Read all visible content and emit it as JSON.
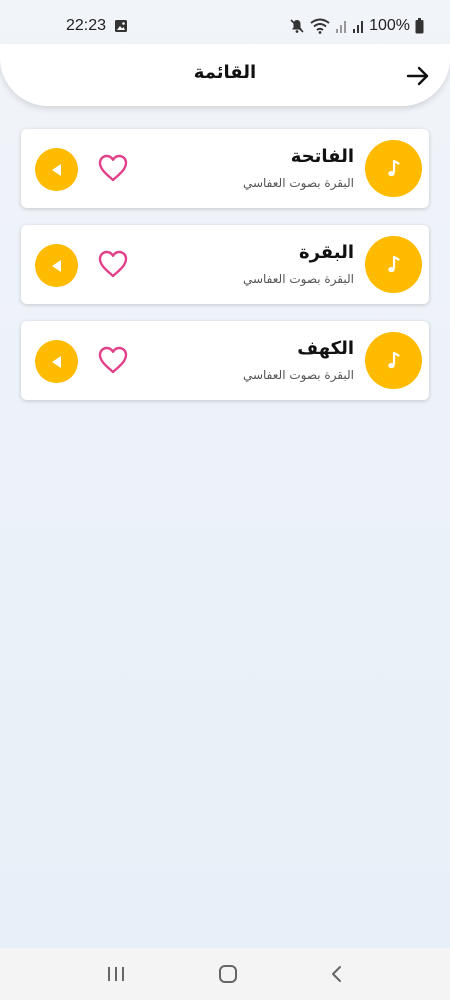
{
  "status_bar": {
    "time": "22:23",
    "battery": "100%",
    "icons": [
      "gallery-icon",
      "mute-icon",
      "wifi-icon",
      "signal-icon",
      "signal-icon",
      "battery-icon"
    ]
  },
  "header": {
    "title": "القائمة",
    "back_icon": "arrow-right-icon"
  },
  "tracks": [
    {
      "title": "الفاتحة",
      "subtitle": "البقرة بصوت العفاسي"
    },
    {
      "title": "البقرة",
      "subtitle": "البقرة بصوت العفاسي"
    },
    {
      "title": "الكهف",
      "subtitle": "البقرة بصوت العفاسي"
    }
  ],
  "colors": {
    "accent": "#ffbb00",
    "heart": "#e0418a",
    "background": "#eaf0f7"
  },
  "nav_bar": {
    "icons": [
      "recent-apps-icon",
      "home-icon",
      "back-icon"
    ]
  }
}
